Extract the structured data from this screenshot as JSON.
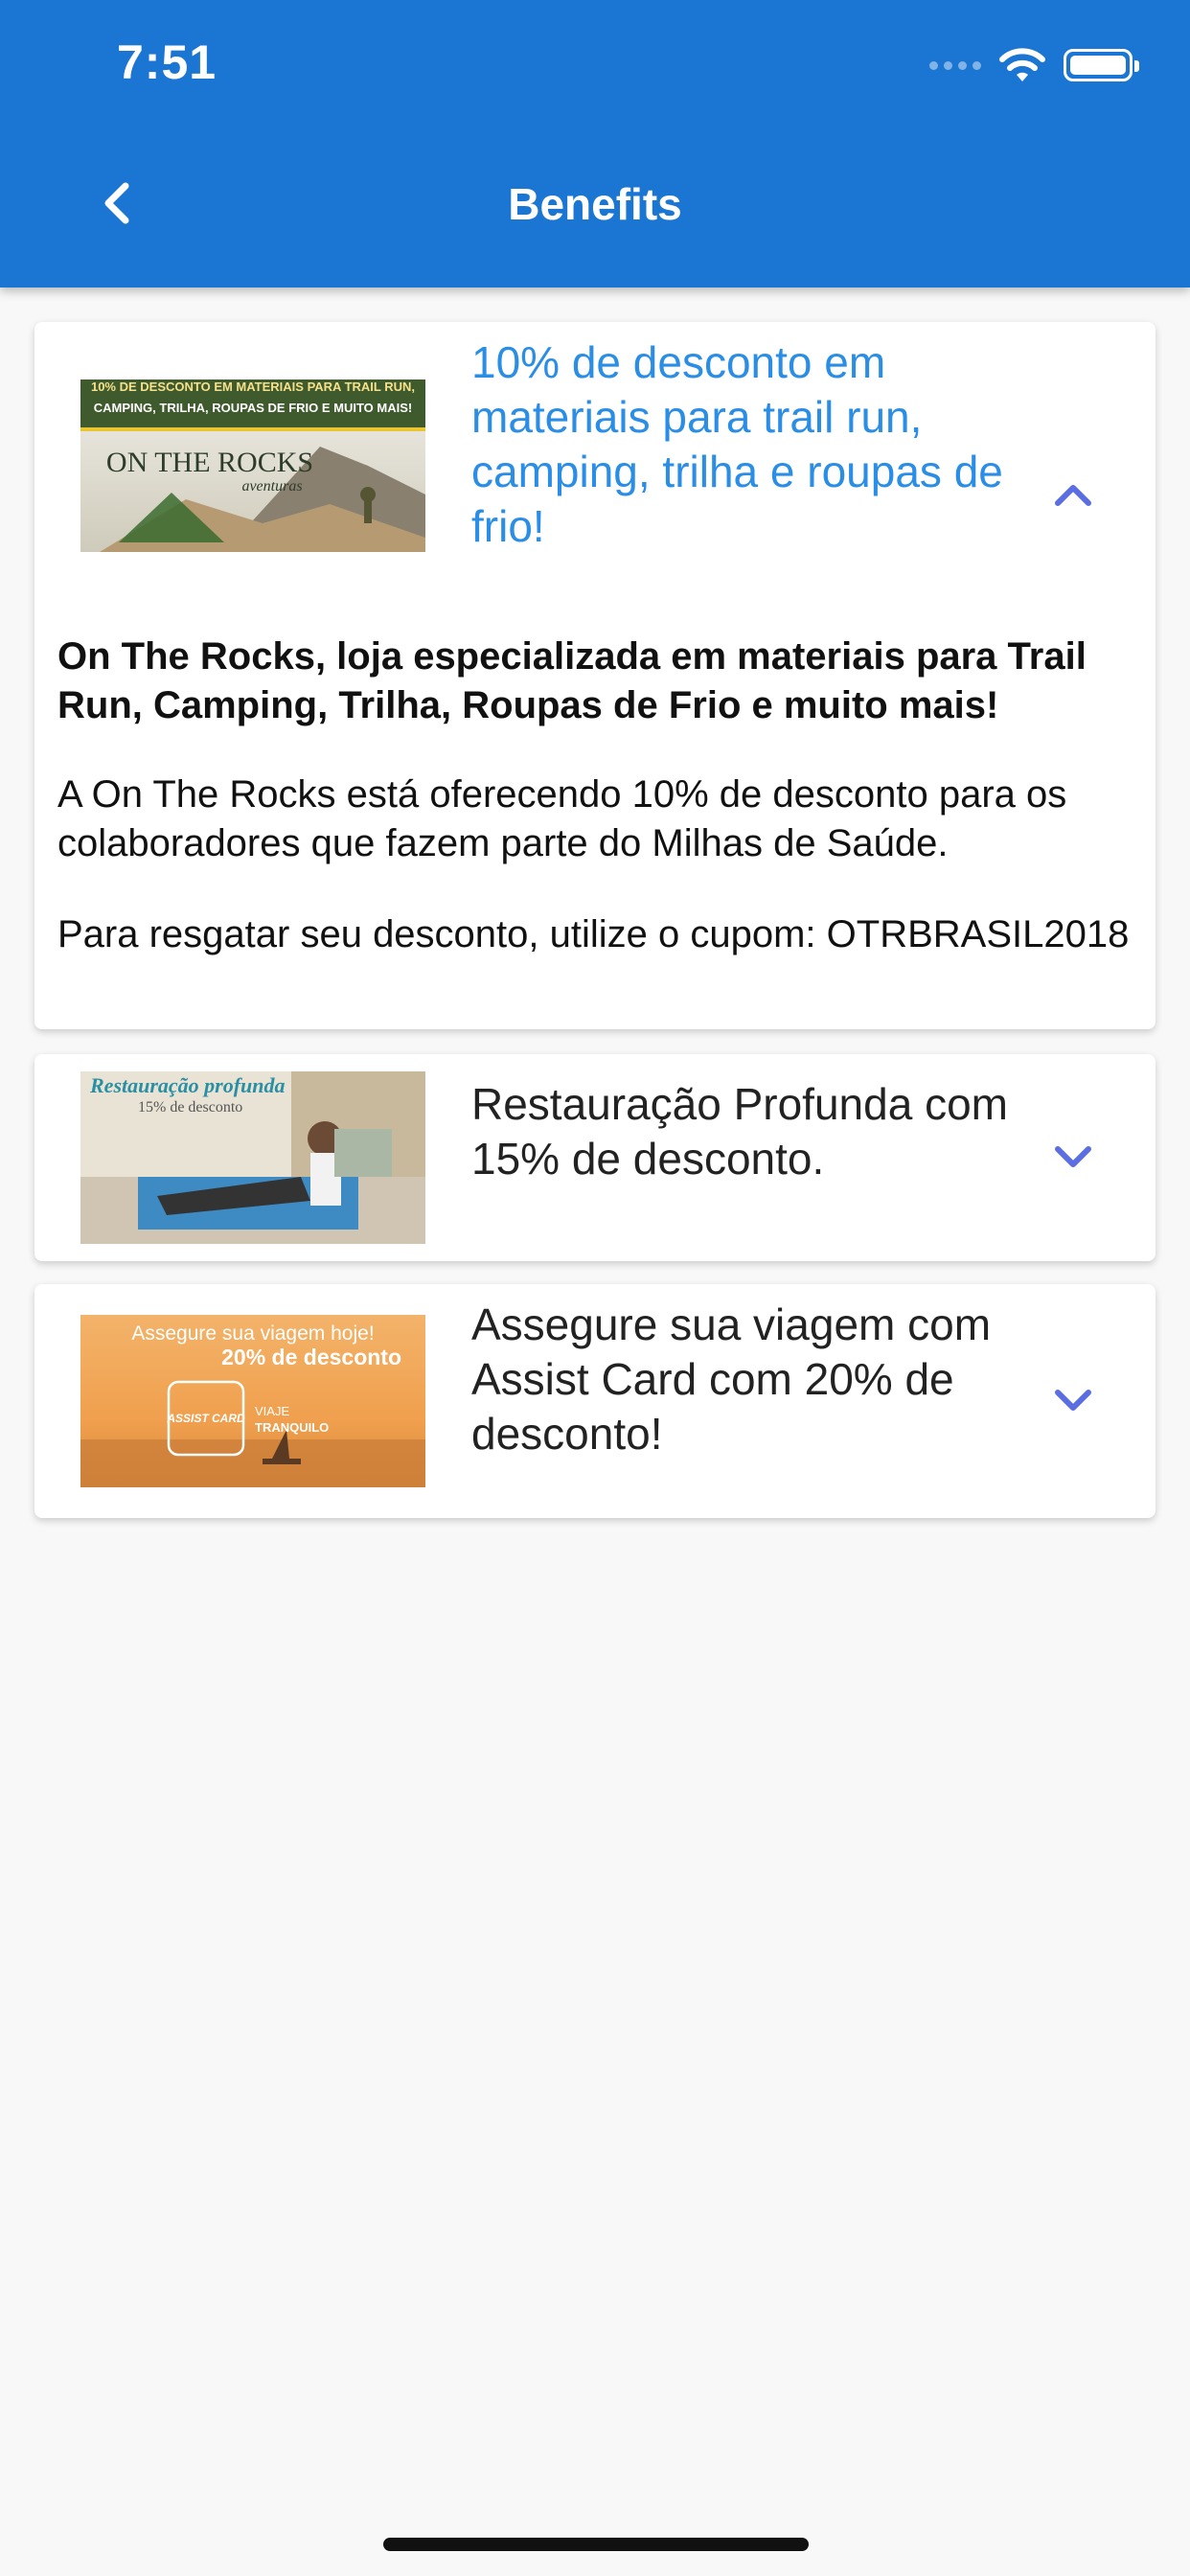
{
  "status": {
    "time": "7:51"
  },
  "header": {
    "title": "Benefits"
  },
  "benefits": [
    {
      "title": "10% de desconto em materiais para trail run, camping, trilha e roupas de frio!",
      "expanded": true,
      "image": {
        "banner_top": "10% DE DESCONTO EM MATERIAIS PARA TRAIL RUN,",
        "banner_sub": "CAMPING, TRILHA, ROUPAS DE FRIO E MUITO MAIS!",
        "logo_main": "ON THE ROCKS",
        "logo_sub": "aventuras"
      },
      "heading": "On The Rocks, loja especializada em materiais para Trail Run, Camping, Trilha, Roupas de Frio e muito mais!",
      "paragraph1": "A On The Rocks está oferecendo 10% de desconto para os colaboradores que fazem parte do Milhas de Saúde.",
      "paragraph2": "Para resgatar seu desconto, utilize o cupom: OTRBRASIL2018"
    },
    {
      "title": "Restauração Profunda com 15% de desconto.",
      "expanded": false,
      "image": {
        "heading": "Restauração profunda",
        "sub": "15% de desconto"
      }
    },
    {
      "title": "Assegure sua viagem com Assist Card com 20% de desconto!",
      "expanded": false,
      "image": {
        "line1": "Assegure sua viagem hoje!",
        "line2": "20% de desconto",
        "logo": "ASSIST CARD",
        "tag1": "VIAJE",
        "tag2": "TRANQUILO"
      }
    }
  ],
  "colors": {
    "appbar": "#1a76d2",
    "expanded_title": "#2a8de6",
    "chevron": "#5b6ee1"
  }
}
